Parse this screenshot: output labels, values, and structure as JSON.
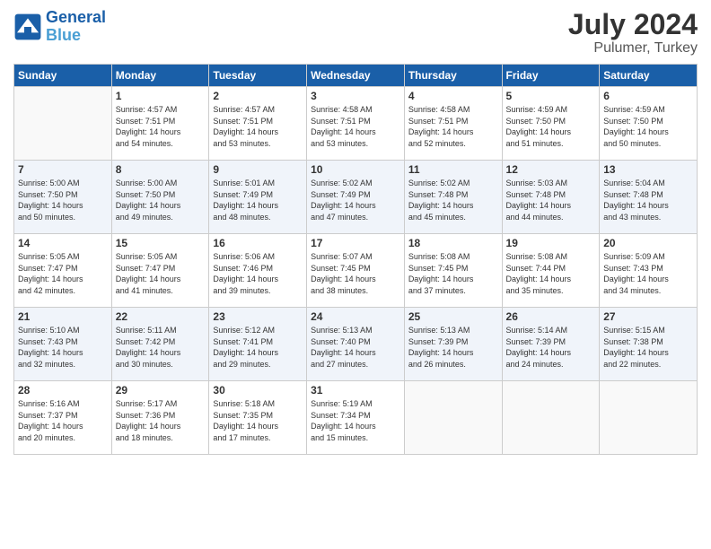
{
  "header": {
    "logo_line1": "General",
    "logo_line2": "Blue",
    "month_year": "July 2024",
    "location": "Pulumer, Turkey"
  },
  "weekdays": [
    "Sunday",
    "Monday",
    "Tuesday",
    "Wednesday",
    "Thursday",
    "Friday",
    "Saturday"
  ],
  "weeks": [
    [
      {
        "day": "",
        "sunrise": "",
        "sunset": "",
        "daylight": ""
      },
      {
        "day": "1",
        "sunrise": "Sunrise: 4:57 AM",
        "sunset": "Sunset: 7:51 PM",
        "daylight": "Daylight: 14 hours and 54 minutes."
      },
      {
        "day": "2",
        "sunrise": "Sunrise: 4:57 AM",
        "sunset": "Sunset: 7:51 PM",
        "daylight": "Daylight: 14 hours and 53 minutes."
      },
      {
        "day": "3",
        "sunrise": "Sunrise: 4:58 AM",
        "sunset": "Sunset: 7:51 PM",
        "daylight": "Daylight: 14 hours and 53 minutes."
      },
      {
        "day": "4",
        "sunrise": "Sunrise: 4:58 AM",
        "sunset": "Sunset: 7:51 PM",
        "daylight": "Daylight: 14 hours and 52 minutes."
      },
      {
        "day": "5",
        "sunrise": "Sunrise: 4:59 AM",
        "sunset": "Sunset: 7:50 PM",
        "daylight": "Daylight: 14 hours and 51 minutes."
      },
      {
        "day": "6",
        "sunrise": "Sunrise: 4:59 AM",
        "sunset": "Sunset: 7:50 PM",
        "daylight": "Daylight: 14 hours and 50 minutes."
      }
    ],
    [
      {
        "day": "7",
        "sunrise": "Sunrise: 5:00 AM",
        "sunset": "Sunset: 7:50 PM",
        "daylight": "Daylight: 14 hours and 50 minutes."
      },
      {
        "day": "8",
        "sunrise": "Sunrise: 5:00 AM",
        "sunset": "Sunset: 7:50 PM",
        "daylight": "Daylight: 14 hours and 49 minutes."
      },
      {
        "day": "9",
        "sunrise": "Sunrise: 5:01 AM",
        "sunset": "Sunset: 7:49 PM",
        "daylight": "Daylight: 14 hours and 48 minutes."
      },
      {
        "day": "10",
        "sunrise": "Sunrise: 5:02 AM",
        "sunset": "Sunset: 7:49 PM",
        "daylight": "Daylight: 14 hours and 47 minutes."
      },
      {
        "day": "11",
        "sunrise": "Sunrise: 5:02 AM",
        "sunset": "Sunset: 7:48 PM",
        "daylight": "Daylight: 14 hours and 45 minutes."
      },
      {
        "day": "12",
        "sunrise": "Sunrise: 5:03 AM",
        "sunset": "Sunset: 7:48 PM",
        "daylight": "Daylight: 14 hours and 44 minutes."
      },
      {
        "day": "13",
        "sunrise": "Sunrise: 5:04 AM",
        "sunset": "Sunset: 7:48 PM",
        "daylight": "Daylight: 14 hours and 43 minutes."
      }
    ],
    [
      {
        "day": "14",
        "sunrise": "Sunrise: 5:05 AM",
        "sunset": "Sunset: 7:47 PM",
        "daylight": "Daylight: 14 hours and 42 minutes."
      },
      {
        "day": "15",
        "sunrise": "Sunrise: 5:05 AM",
        "sunset": "Sunset: 7:47 PM",
        "daylight": "Daylight: 14 hours and 41 minutes."
      },
      {
        "day": "16",
        "sunrise": "Sunrise: 5:06 AM",
        "sunset": "Sunset: 7:46 PM",
        "daylight": "Daylight: 14 hours and 39 minutes."
      },
      {
        "day": "17",
        "sunrise": "Sunrise: 5:07 AM",
        "sunset": "Sunset: 7:45 PM",
        "daylight": "Daylight: 14 hours and 38 minutes."
      },
      {
        "day": "18",
        "sunrise": "Sunrise: 5:08 AM",
        "sunset": "Sunset: 7:45 PM",
        "daylight": "Daylight: 14 hours and 37 minutes."
      },
      {
        "day": "19",
        "sunrise": "Sunrise: 5:08 AM",
        "sunset": "Sunset: 7:44 PM",
        "daylight": "Daylight: 14 hours and 35 minutes."
      },
      {
        "day": "20",
        "sunrise": "Sunrise: 5:09 AM",
        "sunset": "Sunset: 7:43 PM",
        "daylight": "Daylight: 14 hours and 34 minutes."
      }
    ],
    [
      {
        "day": "21",
        "sunrise": "Sunrise: 5:10 AM",
        "sunset": "Sunset: 7:43 PM",
        "daylight": "Daylight: 14 hours and 32 minutes."
      },
      {
        "day": "22",
        "sunrise": "Sunrise: 5:11 AM",
        "sunset": "Sunset: 7:42 PM",
        "daylight": "Daylight: 14 hours and 30 minutes."
      },
      {
        "day": "23",
        "sunrise": "Sunrise: 5:12 AM",
        "sunset": "Sunset: 7:41 PM",
        "daylight": "Daylight: 14 hours and 29 minutes."
      },
      {
        "day": "24",
        "sunrise": "Sunrise: 5:13 AM",
        "sunset": "Sunset: 7:40 PM",
        "daylight": "Daylight: 14 hours and 27 minutes."
      },
      {
        "day": "25",
        "sunrise": "Sunrise: 5:13 AM",
        "sunset": "Sunset: 7:39 PM",
        "daylight": "Daylight: 14 hours and 26 minutes."
      },
      {
        "day": "26",
        "sunrise": "Sunrise: 5:14 AM",
        "sunset": "Sunset: 7:39 PM",
        "daylight": "Daylight: 14 hours and 24 minutes."
      },
      {
        "day": "27",
        "sunrise": "Sunrise: 5:15 AM",
        "sunset": "Sunset: 7:38 PM",
        "daylight": "Daylight: 14 hours and 22 minutes."
      }
    ],
    [
      {
        "day": "28",
        "sunrise": "Sunrise: 5:16 AM",
        "sunset": "Sunset: 7:37 PM",
        "daylight": "Daylight: 14 hours and 20 minutes."
      },
      {
        "day": "29",
        "sunrise": "Sunrise: 5:17 AM",
        "sunset": "Sunset: 7:36 PM",
        "daylight": "Daylight: 14 hours and 18 minutes."
      },
      {
        "day": "30",
        "sunrise": "Sunrise: 5:18 AM",
        "sunset": "Sunset: 7:35 PM",
        "daylight": "Daylight: 14 hours and 17 minutes."
      },
      {
        "day": "31",
        "sunrise": "Sunrise: 5:19 AM",
        "sunset": "Sunset: 7:34 PM",
        "daylight": "Daylight: 14 hours and 15 minutes."
      },
      {
        "day": "",
        "sunrise": "",
        "sunset": "",
        "daylight": ""
      },
      {
        "day": "",
        "sunrise": "",
        "sunset": "",
        "daylight": ""
      },
      {
        "day": "",
        "sunrise": "",
        "sunset": "",
        "daylight": ""
      }
    ]
  ]
}
